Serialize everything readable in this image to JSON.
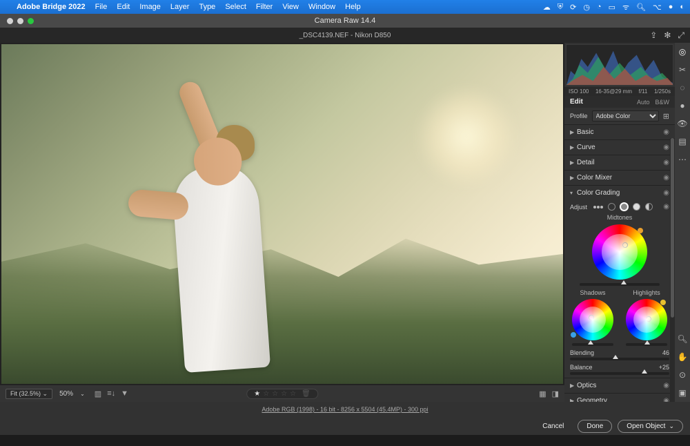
{
  "menubar": {
    "app": "Adobe Bridge 2022",
    "items": [
      "File",
      "Edit",
      "Image",
      "Layer",
      "Type",
      "Select",
      "Filter",
      "View",
      "Window",
      "Help"
    ]
  },
  "window": {
    "title": "Camera Raw 14.4",
    "subtitle": "_DSC4139.NEF  -  Nikon D850"
  },
  "canvas": {
    "fit": "Fit (32.5%)",
    "zoom_preset": "50%",
    "rating": 1
  },
  "histogram": {
    "iso": "ISO 100",
    "lens": "16-35@29 mm",
    "aperture": "f/11",
    "shutter": "1/250s"
  },
  "edit": {
    "label": "Edit",
    "auto": "Auto",
    "bw": "B&W",
    "profile_label": "Profile",
    "profile_value": "Adobe Color"
  },
  "sections": {
    "basic": "Basic",
    "curve": "Curve",
    "detail": "Detail",
    "color_mixer": "Color Mixer",
    "color_grading": "Color Grading",
    "optics": "Optics",
    "geometry": "Geometry"
  },
  "color_grading": {
    "adjust": "Adjust",
    "midtones": "Midtones",
    "shadows": "Shadows",
    "highlights": "Highlights",
    "blending_label": "Blending",
    "blending_value": "46",
    "balance_label": "Balance",
    "balance_value": "+25"
  },
  "footer": {
    "meta": "Adobe RGB (1998) - 16 bit - 8256 x 5504 (45.4MP) - 300 ppi",
    "cancel": "Cancel",
    "done": "Done",
    "open_object": "Open Object"
  }
}
